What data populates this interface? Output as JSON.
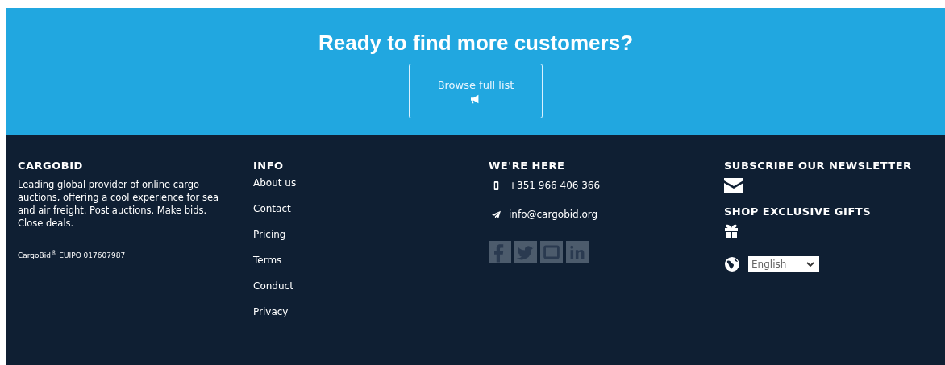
{
  "cta": {
    "heading": "Ready to find more customers?",
    "button": "Browse full list"
  },
  "footer": {
    "about": {
      "title": "CARGOBID",
      "text": "Leading global provider of online cargo auctions, offering a cool experience for sea and air freight. Post auctions. Make bids. Close deals.",
      "trademark": "CargoBid$^{®}$ EUIPO 017607987"
    },
    "info": {
      "title": "INFO",
      "links": [
        "About us",
        "Contact",
        "Pricing",
        "Terms",
        "Conduct",
        "Privacy"
      ]
    },
    "contact": {
      "title": "WE'RE HERE",
      "items": [
        {
          "kind": "phone",
          "text": "+351 966 406 366"
        },
        {
          "kind": "email",
          "text": "info@cargobid.org"
        }
      ],
      "social": [
        {
          "kind": "facebook"
        },
        {
          "kind": "twitter"
        },
        {
          "kind": "instagram"
        },
        {
          "kind": "linkedin"
        }
      ]
    },
    "newsletter": {
      "title": "SUBSCRIBE OUR NEWSLETTER"
    },
    "gifts": {
      "title": "SHOP EXCLUSIVE GIFTS"
    },
    "language": {
      "value": "English"
    }
  }
}
